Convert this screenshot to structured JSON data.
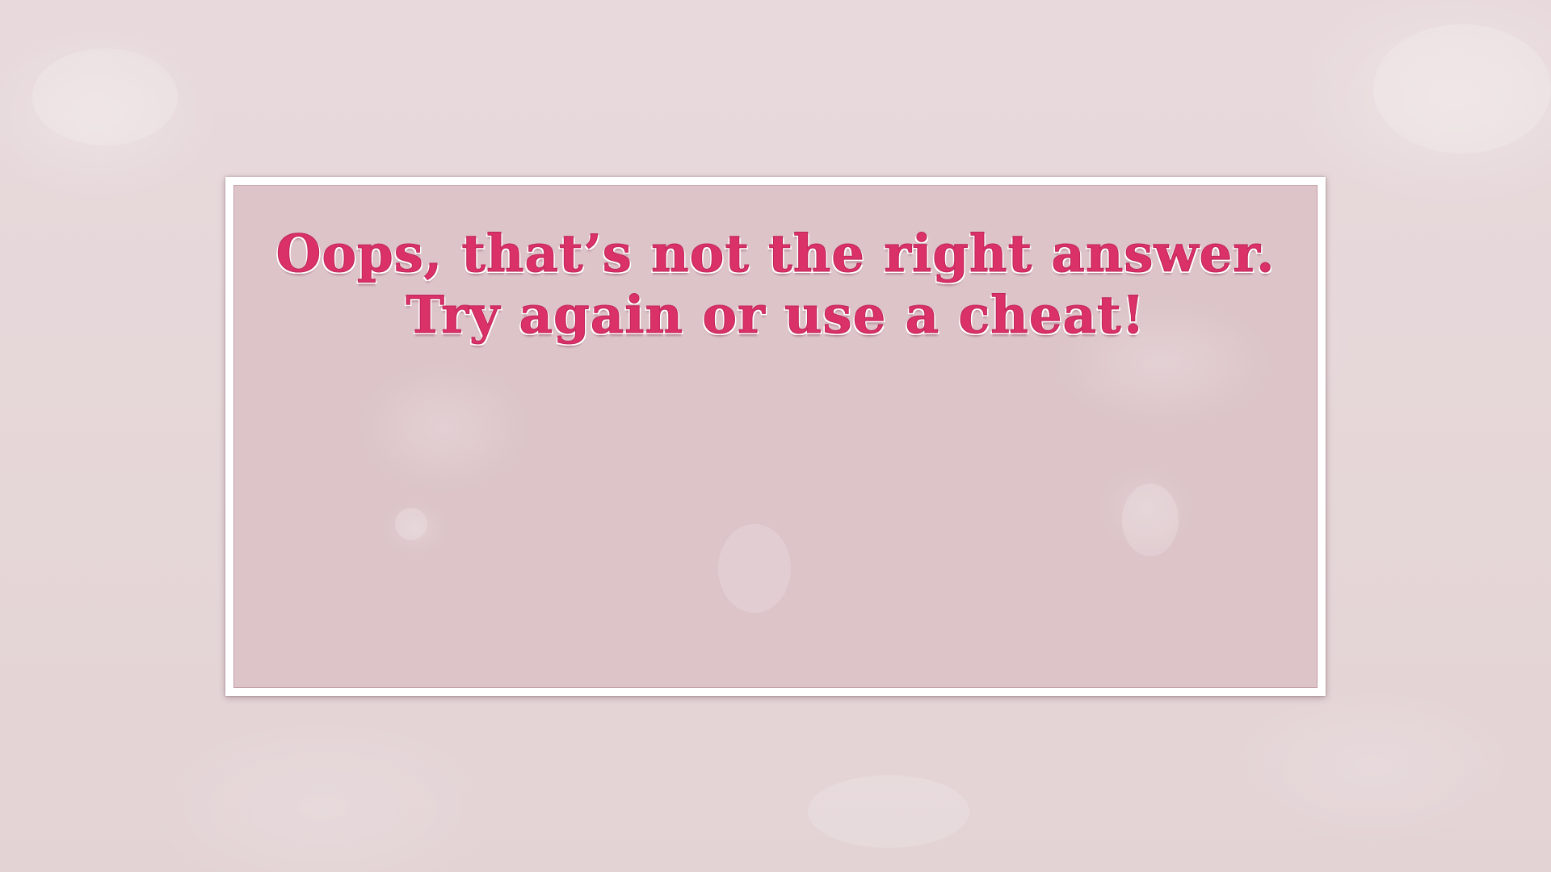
{
  "dialog": {
    "message_line1": "Oops, that’s not the right answer.",
    "message_line2": "Try again or use a cheat!"
  },
  "colors": {
    "background": "#e6d7d9",
    "panel_fill": "#dcc4c8",
    "panel_border": "#ffffff",
    "message_text": "#d93168"
  }
}
